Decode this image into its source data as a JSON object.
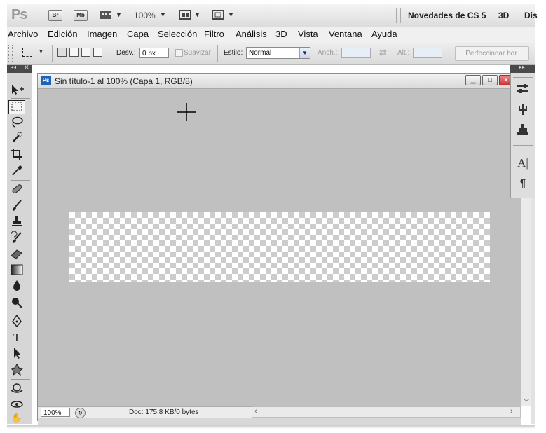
{
  "appbar": {
    "logo": "Ps",
    "bridge": "Br",
    "minibridge": "Mb",
    "zoom": "100%",
    "workspace": "Novedades de CS 5",
    "workspace_3d": "3D",
    "workspace_more": "Dis"
  },
  "menu": [
    "Archivo",
    "Edición",
    "Imagen",
    "Capa",
    "Selección",
    "Filtro",
    "Análisis",
    "3D",
    "Vista",
    "Ventana",
    "Ayuda"
  ],
  "options": {
    "feather_label": "Desv.:",
    "feather_value": "0 px",
    "antialias_label": "Suavizar",
    "style_label": "Estilo:",
    "style_value": "Normal",
    "width_label": "Anch.:",
    "height_label": "Alt.:",
    "refine_button": "Perfeccionar bor."
  },
  "document": {
    "icon": "Ps",
    "title": "Sin título-1 al 100% (Capa 1, RGB/8)"
  },
  "status": {
    "zoom": "100%",
    "doc_info": "Doc: 175.8 KB/0 bytes"
  },
  "tools": [
    "move-tool-icon",
    "marquee-tool-icon",
    "lasso-tool-icon",
    "quick-selection-tool-icon",
    "crop-tool-icon",
    "eyedropper-tool-icon",
    "spot-healing-tool-icon",
    "brush-tool-icon",
    "clone-stamp-tool-icon",
    "history-brush-tool-icon",
    "eraser-tool-icon",
    "gradient-tool-icon",
    "blur-tool-icon",
    "dodge-tool-icon",
    "pen-tool-icon",
    "type-tool-icon",
    "path-selection-tool-icon",
    "shape-tool-icon",
    "3d-rotate-tool-icon",
    "3d-orbit-tool-icon",
    "hand-tool-icon"
  ],
  "dock": [
    "adjustments-panel-icon",
    "masks-panel-icon",
    "clone-source-panel-icon",
    "character-panel-icon",
    "paragraph-panel-icon"
  ],
  "colors": {
    "pasteboard": "#c0c0c0",
    "doc_icon": "#1f63b8",
    "close_button": "#cc3333"
  }
}
